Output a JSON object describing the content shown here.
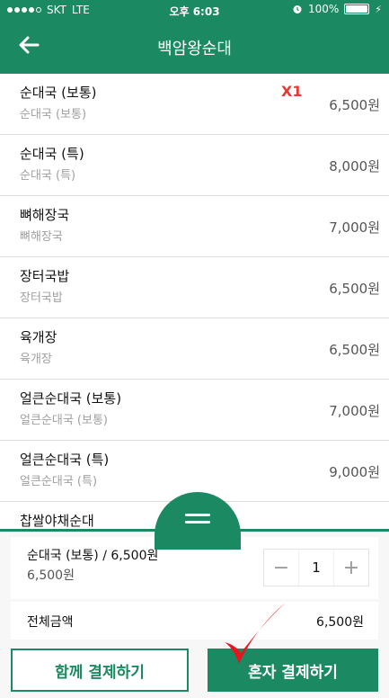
{
  "status_bar": {
    "carrier": "SKT",
    "network": "LTE",
    "time": "오후 6:03",
    "battery": "100%"
  },
  "nav": {
    "title": "백암왕순대"
  },
  "menu": [
    {
      "name": "순대국 (보통)",
      "sub": "순대국 (보통)",
      "price": "6,500원",
      "qty": "X1"
    },
    {
      "name": "순대국 (특)",
      "sub": "순대국 (특)",
      "price": "8,000원"
    },
    {
      "name": "뼈해장국",
      "sub": "뼈해장국",
      "price": "7,000원"
    },
    {
      "name": "장터국밥",
      "sub": "장터국밥",
      "price": "6,500원"
    },
    {
      "name": "육개장",
      "sub": "육개장",
      "price": "6,500원"
    },
    {
      "name": "얼큰순대국 (보통)",
      "sub": "얼큰순대국 (보통)",
      "price": "7,000원"
    },
    {
      "name": "얼큰순대국 (특)",
      "sub": "얼큰순대국 (특)",
      "price": "9,000원"
    },
    {
      "name": "찹쌀야채순대",
      "sub": "",
      "price": ""
    }
  ],
  "order": {
    "title": "순대국 (보통) / 6,500원",
    "sub": "6,500원",
    "quantity": "1",
    "minus": "−",
    "plus": "+"
  },
  "total": {
    "label": "전체금액",
    "amount": "6,500원"
  },
  "buttons": {
    "pay_together": "함께 결제하기",
    "pay_alone": "혼자 결제하기"
  },
  "colors": {
    "primary": "#1b8a62",
    "quantity_badge": "#e53935",
    "check_mark": "#e8141e"
  }
}
